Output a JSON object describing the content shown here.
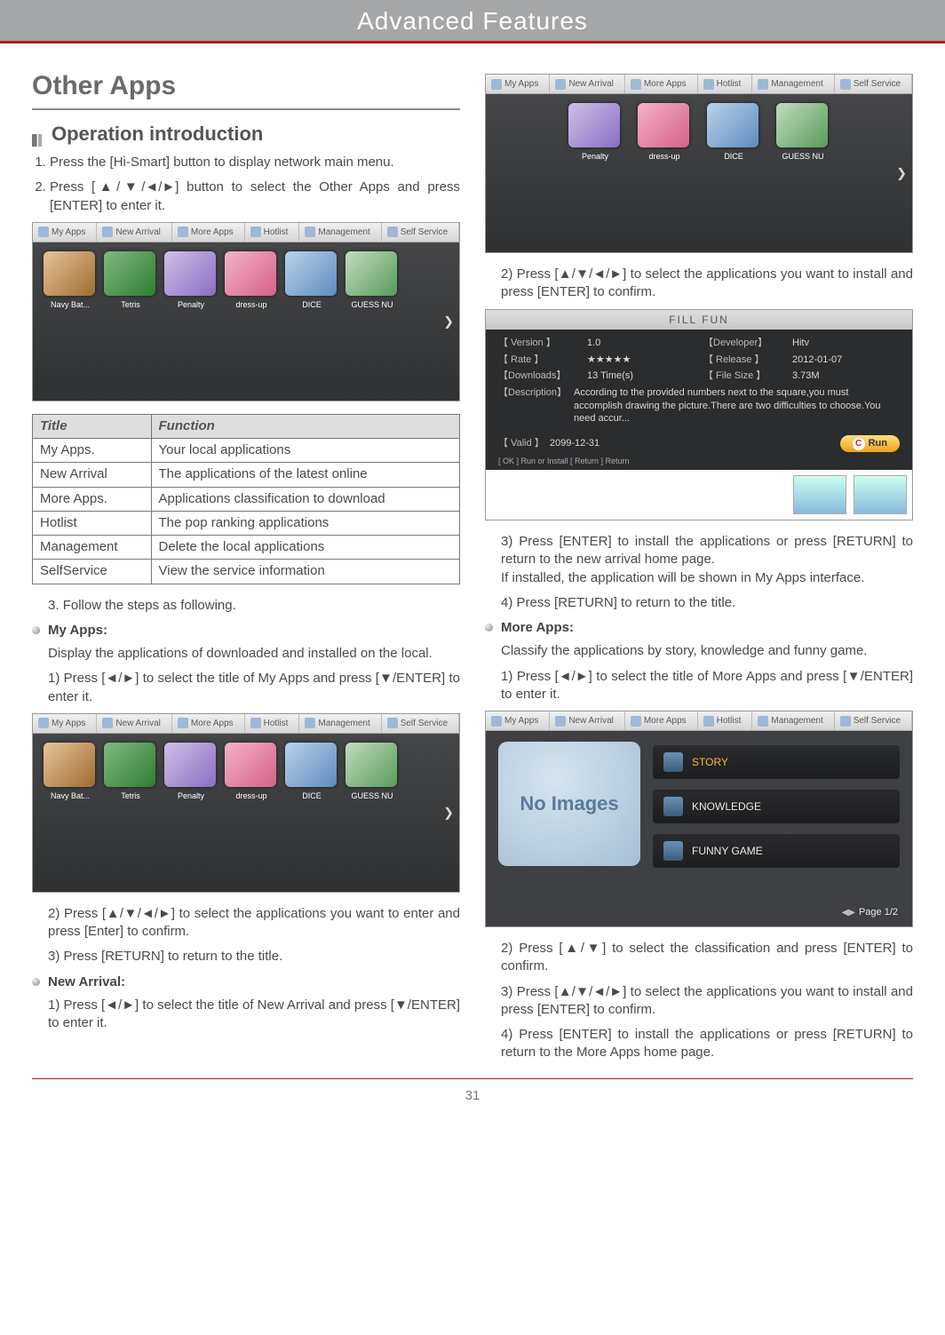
{
  "header": {
    "title": "Advanced Features"
  },
  "section": {
    "title": "Other Apps",
    "subtitle": "Operation introduction"
  },
  "steps": {
    "s1": "Press the [Hi-Smart] button to display network main menu.",
    "s2": "Press [▲/▼/◄/►] button to select the Other Apps and press [ENTER] to enter it.",
    "s3": "Follow the steps as following."
  },
  "tv_tabs": [
    "My Apps",
    "New Arrival",
    "More Apps",
    "Hotlist",
    "Management",
    "Self Service"
  ],
  "apps_full": [
    {
      "label": "Navy Bat..."
    },
    {
      "label": "Tetris"
    },
    {
      "label": "Penalty"
    },
    {
      "label": "dress-up"
    },
    {
      "label": "DICE"
    },
    {
      "label": "GUESS NU"
    }
  ],
  "apps_short": [
    {
      "label": "Penalty"
    },
    {
      "label": "dress-up"
    },
    {
      "label": "DICE"
    },
    {
      "label": "GUESS NU"
    }
  ],
  "func_table": {
    "head": {
      "title": "Title",
      "func": "Function"
    },
    "rows": [
      {
        "title": "My Apps.",
        "func": "Your local applications"
      },
      {
        "title": "New Arrival",
        "func": "The applications of the latest online"
      },
      {
        "title": "More Apps.",
        "func": "Applications classification to download"
      },
      {
        "title": "Hotlist",
        "func": "The pop ranking applications"
      },
      {
        "title": "Management",
        "func": "Delete the local applications"
      },
      {
        "title": "SelfService",
        "func": "View the service information"
      }
    ]
  },
  "myapps": {
    "heading": "My Apps:",
    "desc": "Display the applications of downloaded and installed on the local.",
    "p1": "Press [◄/►] to select the title of My Apps and press [▼/ENTER] to enter it.",
    "p2": "Press [▲/▼/◄/►] to select the applications you want to enter and press [Enter] to confirm.",
    "p3": "Press [RETURN] to return to the title."
  },
  "newarrival": {
    "heading": "New Arrival:",
    "p1": "Press [◄/►] to select the title of New Arrival and press [▼/ENTER] to enter it.",
    "p2": "Press [▲/▼/◄/►] to select the applications you want to install and press [ENTER] to confirm.",
    "p3": "Press [ENTER] to install the applications or press [RETURN] to return to the new arrival home page.",
    "p3b": "If installed, the application will be shown in My Apps interface.",
    "p4": "Press [RETURN] to return to the title."
  },
  "detail": {
    "title": "FILL FUN",
    "version_lbl": "【 Version 】",
    "version": "1.0",
    "dev_lbl": "【Developer】",
    "dev": "Hitv",
    "rate_lbl": "【 Rate 】",
    "rate": "★★★★★",
    "release_lbl": "【 Release 】",
    "release": "2012-01-07",
    "dl_lbl": "【Downloads】",
    "dl": "13 Time(s)",
    "size_lbl": "【 File Size 】",
    "size": "3.73M",
    "desc_lbl": "【Description】",
    "desc": "According to the provided numbers next to the square,you must accomplish drawing the picture.There are two difficulties to choose.You need accur...",
    "valid_lbl": "【 Valid 】",
    "valid": "2099-12-31",
    "run": "Run",
    "hints": "[ OK ] Run or Install    [ Return ] Return"
  },
  "moreapps": {
    "heading": "More Apps:",
    "desc": "Classify the applications by story, knowledge and funny game.",
    "p1": "Press [◄/►] to select the title of More Apps and press [▼/ENTER] to enter it.",
    "noimage": "No Images",
    "cats": [
      "STORY",
      "KNOWLEDGE",
      "FUNNY GAME"
    ],
    "page": "Page  1/2",
    "p2": "Press [▲/▼] to select the classification and press [ENTER] to confirm.",
    "p3": "Press [▲/▼/◄/►] to select the applications you want to install and press [ENTER] to confirm.",
    "p4": "Press [ENTER] to install the applications or press [RETURN] to return to the More Apps home page."
  },
  "page_number": "31"
}
